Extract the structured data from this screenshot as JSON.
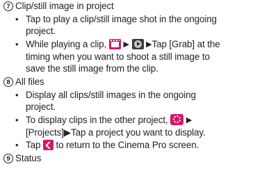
{
  "sections": [
    {
      "number": "7",
      "title": "Clip/still image in project",
      "bullets": [
        {
          "lines": [
            "Tap to play a clip/still image shot in the ongoing",
            "project."
          ]
        },
        {
          "line1_after_icons": "Tap [Grab] at the",
          "line1_prefix": "While playing a clip,",
          "lines": [
            "timing when you want to shoot a still image to",
            "save the still image from the clip."
          ]
        }
      ]
    },
    {
      "number": "8",
      "title": "All files",
      "bullets": [
        {
          "lines": [
            "Display all clips/still images in the ongoing",
            "project."
          ]
        },
        {
          "line1_prefix": "To display clips in the other project,",
          "line2": "[Projects]▶Tap a project you want to display."
        },
        {
          "prefix": "Tap",
          "suffix": "to return to the Cinema Pro screen."
        }
      ]
    },
    {
      "number": "9",
      "title": "Status"
    }
  ],
  "icons": {
    "film": "film-icon",
    "play": "play-icon",
    "reel": "reel-icon",
    "back": "back-arrow-icon",
    "arrow": "▶",
    "bullet": "•"
  },
  "colors": {
    "accent": "#d6176b",
    "text": "#222222"
  }
}
